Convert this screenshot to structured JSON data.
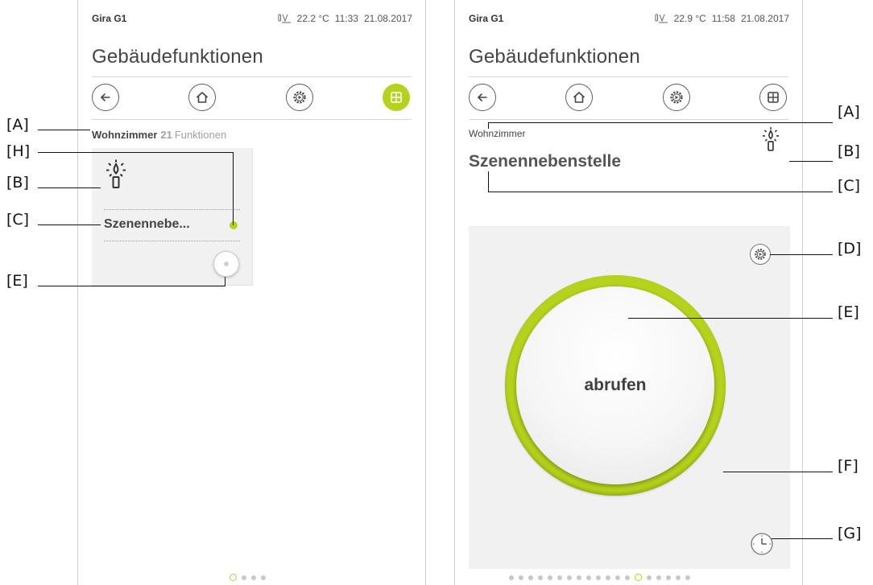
{
  "left_screen": {
    "status": {
      "device": "Gira G1",
      "temperature": "22.2 °C",
      "time": "11:33",
      "date": "21.08.2017"
    },
    "title": "Gebäudefunktionen",
    "room": {
      "name": "Wohnzimmer",
      "count": "21",
      "label": "Funktionen"
    },
    "tile": {
      "label": "Szenennebe...",
      "icon": "candle-light-icon"
    },
    "nav": {
      "back": "back-arrow-icon",
      "home": "home-icon",
      "settings": "gear-play-icon",
      "grid": "grid-icon",
      "active": "grid"
    },
    "pages": {
      "total": 4,
      "current": 1
    }
  },
  "right_screen": {
    "status": {
      "device": "Gira G1",
      "temperature": "22.9 °C",
      "time": "11:58",
      "date": "21.08.2017"
    },
    "title": "Gebäudefunktionen",
    "room": "Wohnzimmer",
    "function_title": "Szenennebenstelle",
    "button_label": "abrufen",
    "nav": {
      "back": "back-arrow-icon",
      "home": "home-icon",
      "settings": "gear-play-icon",
      "grid": "grid-icon"
    },
    "pages": {
      "total": 19,
      "current": 14
    }
  },
  "callouts": {
    "left": [
      "[A]",
      "[H]",
      "[B]",
      "[C]",
      "[E]"
    ],
    "right": [
      "[A]",
      "[B]",
      "[C]",
      "[D]",
      "[E]",
      "[F]",
      "[G]"
    ]
  },
  "colors": {
    "accent": "#b7d21c",
    "panel": "#f1f1f1",
    "text": "#444444",
    "muted": "#a0a0a0"
  }
}
